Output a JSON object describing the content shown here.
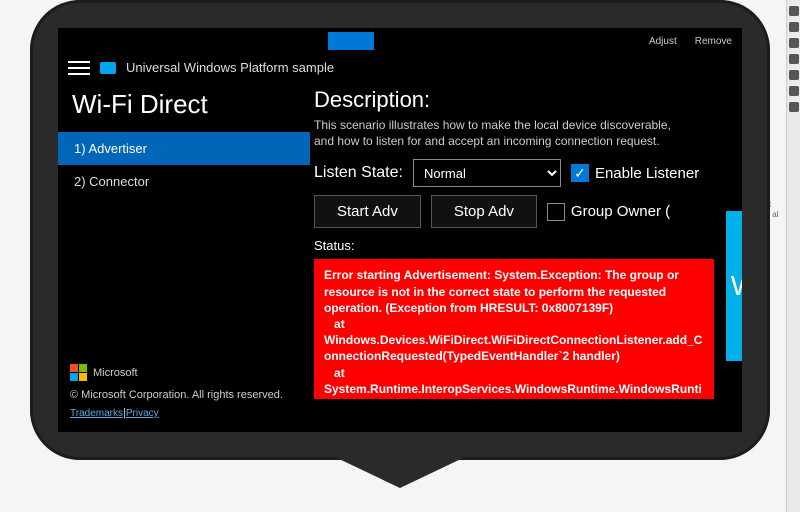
{
  "topbar": {
    "adjust": "Adjust",
    "remove": "Remove"
  },
  "app": {
    "title": "Universal Windows Platform sample"
  },
  "page_title": "Wi-Fi Direct",
  "nav": [
    {
      "label": "1) Advertiser",
      "active": true
    },
    {
      "label": "2) Connector",
      "active": false
    }
  ],
  "description": {
    "heading": "Description:",
    "text": "This scenario illustrates how to make the local device discoverable, and how to listen for and accept an incoming connection request."
  },
  "listen": {
    "label": "Listen State:",
    "selected": "Normal",
    "options": [
      "Normal"
    ]
  },
  "checks": {
    "enable_listener": {
      "label": "Enable Listener",
      "checked": true
    },
    "group_owner": {
      "label": "Group Owner (",
      "checked": false
    }
  },
  "buttons": {
    "start": "Start Adv",
    "stop": "Stop Adv"
  },
  "status_label": "Status:",
  "error_text": "Error starting Advertisement: System.Exception: The group or resource is not in the correct state to perform the requested operation. (Exception from HRESULT: 0x8007139F)\n   at Windows.Devices.WiFiDirect.WiFiDirectConnectionListener.add_ConnectionRequested(TypedEventHandler`2 handler)\n   at System.Runtime.InteropServices.WindowsRuntime.WindowsRuntimeMarshal.NativeOrStaticEventRegistrationImpl.AddEventHandler[T](Func`2 addMethod, Action`1 removeMethod, T handler)",
  "footer": {
    "brand": "Microsoft",
    "copyright": "© Microsoft Corporation. All rights reserved.",
    "link1": "Trademarks",
    "sep": "|",
    "link2": "Privacy"
  },
  "teal_letter": "W",
  "side_snip": "be \"\nstat\nter i\nuild\nal c"
}
